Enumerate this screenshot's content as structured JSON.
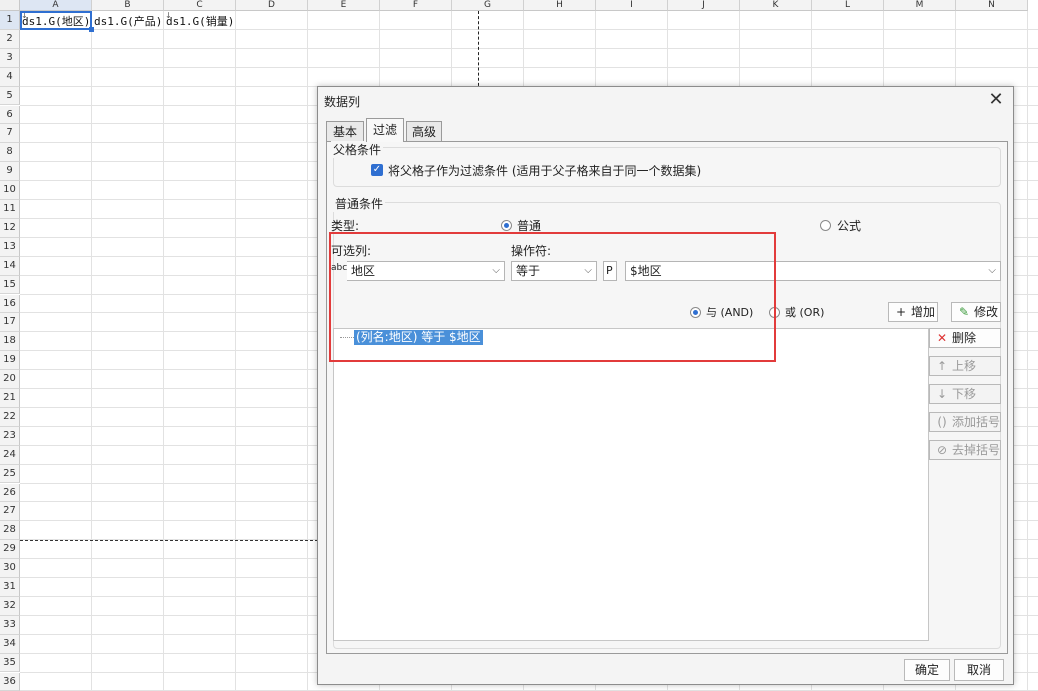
{
  "sheet": {
    "columns": [
      "A",
      "B",
      "C",
      "D",
      "E",
      "F",
      "G",
      "H",
      "I",
      "J",
      "K",
      "L",
      "M",
      "N"
    ],
    "rows": [
      "1",
      "2",
      "3",
      "4",
      "5",
      "6",
      "7",
      "8",
      "9",
      "10",
      "11",
      "12",
      "13",
      "14",
      "15",
      "16",
      "17",
      "18",
      "19",
      "20",
      "21",
      "22",
      "23",
      "24",
      "25",
      "26",
      "27",
      "28",
      "29",
      "30",
      "31",
      "32",
      "33",
      "34",
      "35",
      "36"
    ],
    "cells": {
      "A1": "ds1.G(地区)",
      "B1": "ds1.G(产品)",
      "C1": "ds1.G(销量)"
    },
    "expand_marks": {
      "A1": "↓",
      "C1": "↓"
    }
  },
  "dialog": {
    "title": "数据列",
    "close_icon": "close-icon",
    "tabs": [
      {
        "label": "基本"
      },
      {
        "label": "过滤"
      },
      {
        "label": "高级"
      }
    ],
    "active_tab": "过滤",
    "parent_group": {
      "title": "父格条件",
      "checkbox_label": "将父格子作为过滤条件 (适用于父子格来自于同一个数据集)",
      "checked": true
    },
    "normal_group": {
      "title": "普通条件",
      "type_label": "类型:",
      "type_options": [
        "普通",
        "公式"
      ],
      "type_selected": "普通",
      "column_label": "可选列:",
      "column_value": "地区",
      "operator_label": "操作符:",
      "operator_value": "等于",
      "param_icon_text": "P",
      "value_value": "$地区",
      "logic_options": [
        "与 (AND)",
        "或 (OR)"
      ],
      "logic_selected": "与 (AND)",
      "add_button": "增加",
      "modify_button": "修改"
    },
    "condition_list": [
      "(列名:地区) 等于 $地区"
    ],
    "side_buttons": {
      "delete": "删除",
      "up": "上移",
      "down": "下移",
      "add_bracket": "添加括号",
      "remove_bracket": "去掉括号"
    },
    "footer": {
      "ok": "确定",
      "cancel": "取消"
    },
    "colors": {
      "highlight": "#4a90d9",
      "annotation_box": "#e23b3b",
      "accent": "#2f6fd1"
    }
  }
}
